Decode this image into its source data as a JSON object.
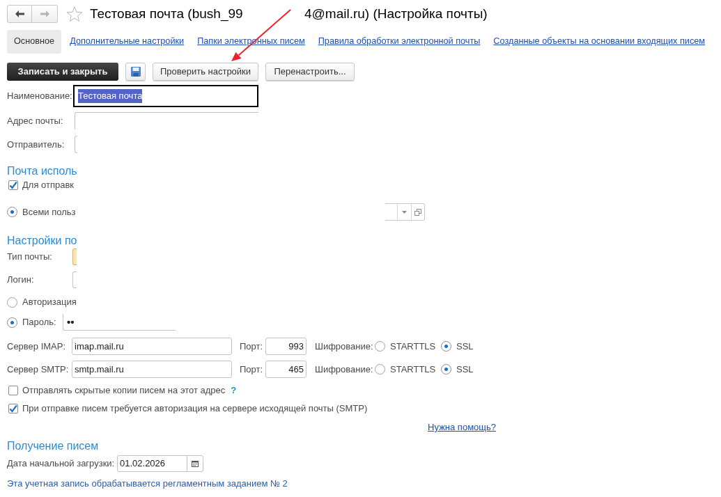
{
  "navigation": {
    "back": {
      "disabled": false
    },
    "forward": {
      "disabled": true
    }
  },
  "window": {
    "favorite": false,
    "title": "Тестовая почта (bush_99",
    "title_end": "4@mail.ru) (Настройка почты)"
  },
  "tabs": [
    {
      "label": "Основное",
      "selected": true
    },
    {
      "label": "Дополнительные настройки",
      "selected": false
    },
    {
      "label": "Папки электронных писем",
      "selected": false
    },
    {
      "label": "Правила обработки электронной почты",
      "selected": false
    },
    {
      "label": "Созданные объекты на основании входящих писем",
      "selected": false
    }
  ],
  "toolbar": [
    {
      "kind": "primary",
      "label": "Записать и закрыть"
    },
    {
      "kind": "save"
    },
    {
      "kind": "default",
      "label": "Проверить настройки"
    },
    {
      "kind": "default",
      "label": "Перенастроить..."
    }
  ],
  "general": [
    {
      "kind": "input",
      "label": "Наименование:",
      "value": "Тестовая почта",
      "focused": true,
      "text_selected": true
    },
    {
      "kind": "input_top",
      "label": "Адрес почты:"
    },
    {
      "kind": "input_edge",
      "label": "Отправитель:"
    }
  ],
  "usage": {
    "heading": "Почта исполь",
    "checkbox": {
      "label": "Для отправк",
      "checked": true
    },
    "radio": {
      "label": "Всеми польз",
      "selected": true
    }
  },
  "connection": {
    "heading": "Настройки по",
    "fields": [
      {
        "label": "Тип почты:",
        "highlighted": true
      },
      {
        "label": "Логин:",
        "highlighted": false
      }
    ],
    "auth": [
      {
        "label": "Авторизация",
        "selected": false
      },
      {
        "label": "Пароль:",
        "selected": true,
        "value": "••"
      }
    ]
  },
  "servers": [
    {
      "label": "Сервер IMAP:",
      "value": "imap.mail.ru",
      "port_label": "Порт:",
      "port": "993",
      "encryption_label": "Шифрование:",
      "options": [
        {
          "label": "STARTTLS",
          "selected": false
        },
        {
          "label": "SSL",
          "selected": true
        }
      ]
    },
    {
      "label": "Сервер SMTP:",
      "value": "smtp.mail.ru",
      "port_label": "Порт:",
      "port": "465",
      "encryption_label": "Шифрование:",
      "options": [
        {
          "label": "STARTTLS",
          "selected": false
        },
        {
          "label": "SSL",
          "selected": true
        }
      ]
    }
  ],
  "options": [
    {
      "label": "Отправлять скрытые копии писем на этот адрес",
      "checked": false,
      "help": "?"
    },
    {
      "label": "При отправке писем требуется авторизация на сервере исходящей почты (SMTP)",
      "checked": true
    }
  ],
  "help_link": "Нужна помощь?",
  "receiving": {
    "heading": "Получение писем",
    "date_label": "Дата начальной загрузки:",
    "date": "01.02.2026"
  },
  "note": "Эта учетная запись обрабатывается регламентным заданием № 2"
}
